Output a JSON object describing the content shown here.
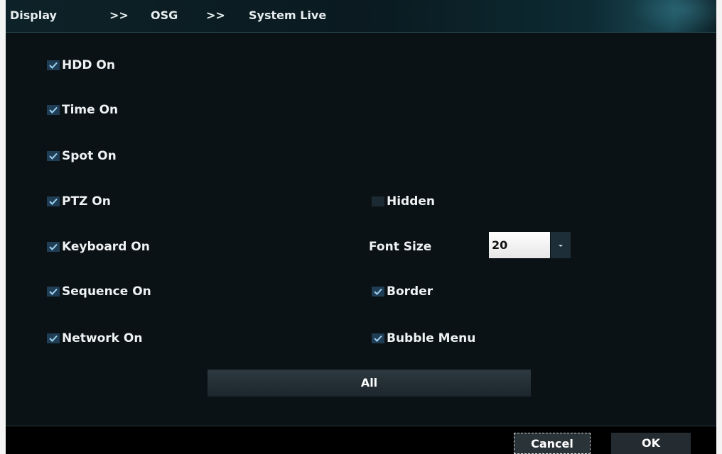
{
  "breadcrumb": {
    "item1": "Display",
    "sep1": ">>",
    "item2": "OSG",
    "sep2": ">>",
    "item3": "System Live"
  },
  "left_options": [
    {
      "label": "HDD On",
      "checked": true
    },
    {
      "label": "Time On",
      "checked": true
    },
    {
      "label": "Spot On",
      "checked": true
    },
    {
      "label": "PTZ On",
      "checked": true
    },
    {
      "label": "Keyboard On",
      "checked": true
    },
    {
      "label": "Sequence On",
      "checked": true
    },
    {
      "label": "Network On",
      "checked": true
    }
  ],
  "right_options": {
    "hidden": {
      "label": "Hidden",
      "checked": false
    },
    "font_size": {
      "label": "Font Size",
      "value": "20"
    },
    "border": {
      "label": "Border",
      "checked": true
    },
    "bubble_menu": {
      "label": "Bubble Menu",
      "checked": true
    }
  },
  "all_button": "All",
  "footer": {
    "cancel": "Cancel",
    "ok": "OK"
  },
  "colors": {
    "background": "#0b1215",
    "checkbox": "#1f3d55",
    "check_mark": "#9fd2f0"
  }
}
